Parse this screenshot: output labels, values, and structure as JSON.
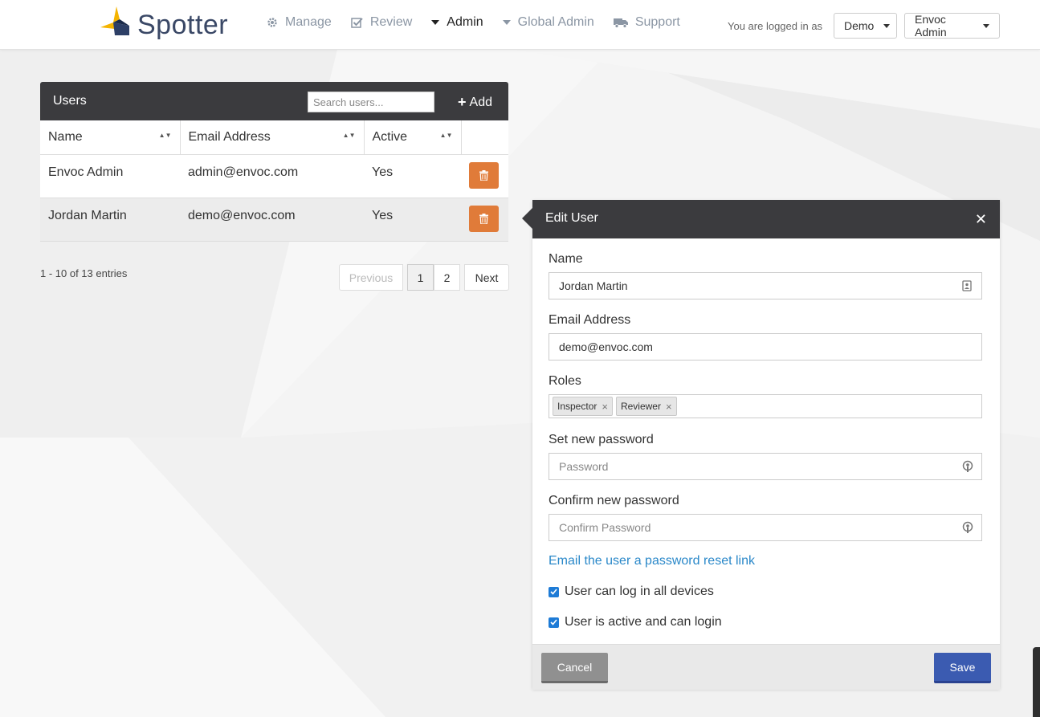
{
  "header": {
    "brand": "Spotter",
    "nav": [
      {
        "label": "Manage",
        "icon": "gear-icon"
      },
      {
        "label": "Review",
        "icon": "check-square-icon"
      },
      {
        "label": "Admin",
        "icon": "caret-down-icon"
      },
      {
        "label": "Global Admin",
        "icon": "caret-down-icon"
      },
      {
        "label": "Support",
        "icon": "truck-icon"
      }
    ],
    "logged_in_text": "You are logged in as",
    "account_select": "Demo",
    "user_menu": "Envoc Admin"
  },
  "users": {
    "title": "Users",
    "search_placeholder": "Search users...",
    "add_label": "Add",
    "columns": [
      "Name",
      "Email Address",
      "Active"
    ],
    "rows": [
      {
        "name": "Envoc Admin",
        "email": "admin@envoc.com",
        "active": "Yes"
      },
      {
        "name": "Jordan Martin",
        "email": "demo@envoc.com",
        "active": "Yes"
      }
    ],
    "entries_text": "1 - 10 of 13 entries",
    "pager": {
      "previous": "Previous",
      "pages": [
        "1",
        "2"
      ],
      "next": "Next"
    }
  },
  "edit": {
    "title": "Edit User",
    "name_label": "Name",
    "name_value": "Jordan Martin",
    "email_label": "Email Address",
    "email_value": "demo@envoc.com",
    "roles_label": "Roles",
    "roles": [
      "Inspector",
      "Reviewer"
    ],
    "password_label": "Set new password",
    "password_placeholder": "Password",
    "confirm_label": "Confirm new password",
    "confirm_placeholder": "Confirm Password",
    "reset_link": "Email the user a password reset link",
    "check_devices": "User can log in all devices",
    "check_active": "User is active and can login",
    "cancel_label": "Cancel",
    "save_label": "Save"
  },
  "colors": {
    "header_dark": "#3b3b3e",
    "delete_orange": "#e07b39",
    "save_blue": "#3b5bb1",
    "link_blue": "#2a88c9"
  }
}
